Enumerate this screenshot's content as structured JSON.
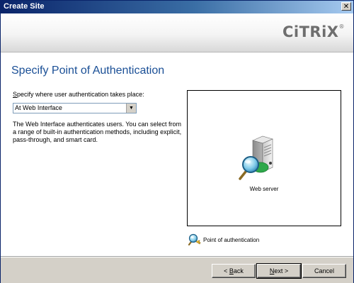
{
  "window": {
    "title": "Create Site",
    "close_glyph": "✕"
  },
  "header": {
    "logo_text": "CiTRiX",
    "logo_mark": "®"
  },
  "main": {
    "page_title": "Specify Point of Authentication",
    "prompt_prefix": "S",
    "prompt_rest": "pecify where user authentication takes place:",
    "select_value": "At Web Interface",
    "select_arrow": "▼",
    "description": "The Web Interface authenticates users. You can select from a range of built-in authentication methods, including explicit, pass-through, and smart card."
  },
  "diagram": {
    "server_label": "Web server",
    "server_icon": "server-magnifier-icon",
    "legend_icon": "magnifier-key-icon",
    "legend_label": "Point of authentication"
  },
  "footer": {
    "back_prefix": "< ",
    "back_hotkey": "B",
    "back_rest": "ack",
    "next_hotkey": "N",
    "next_rest": "ext >",
    "cancel_label": "Cancel"
  },
  "colors": {
    "title_bar": "#0a246a",
    "page_title": "#1a4f96",
    "dialog_face": "#d4d0c8"
  }
}
